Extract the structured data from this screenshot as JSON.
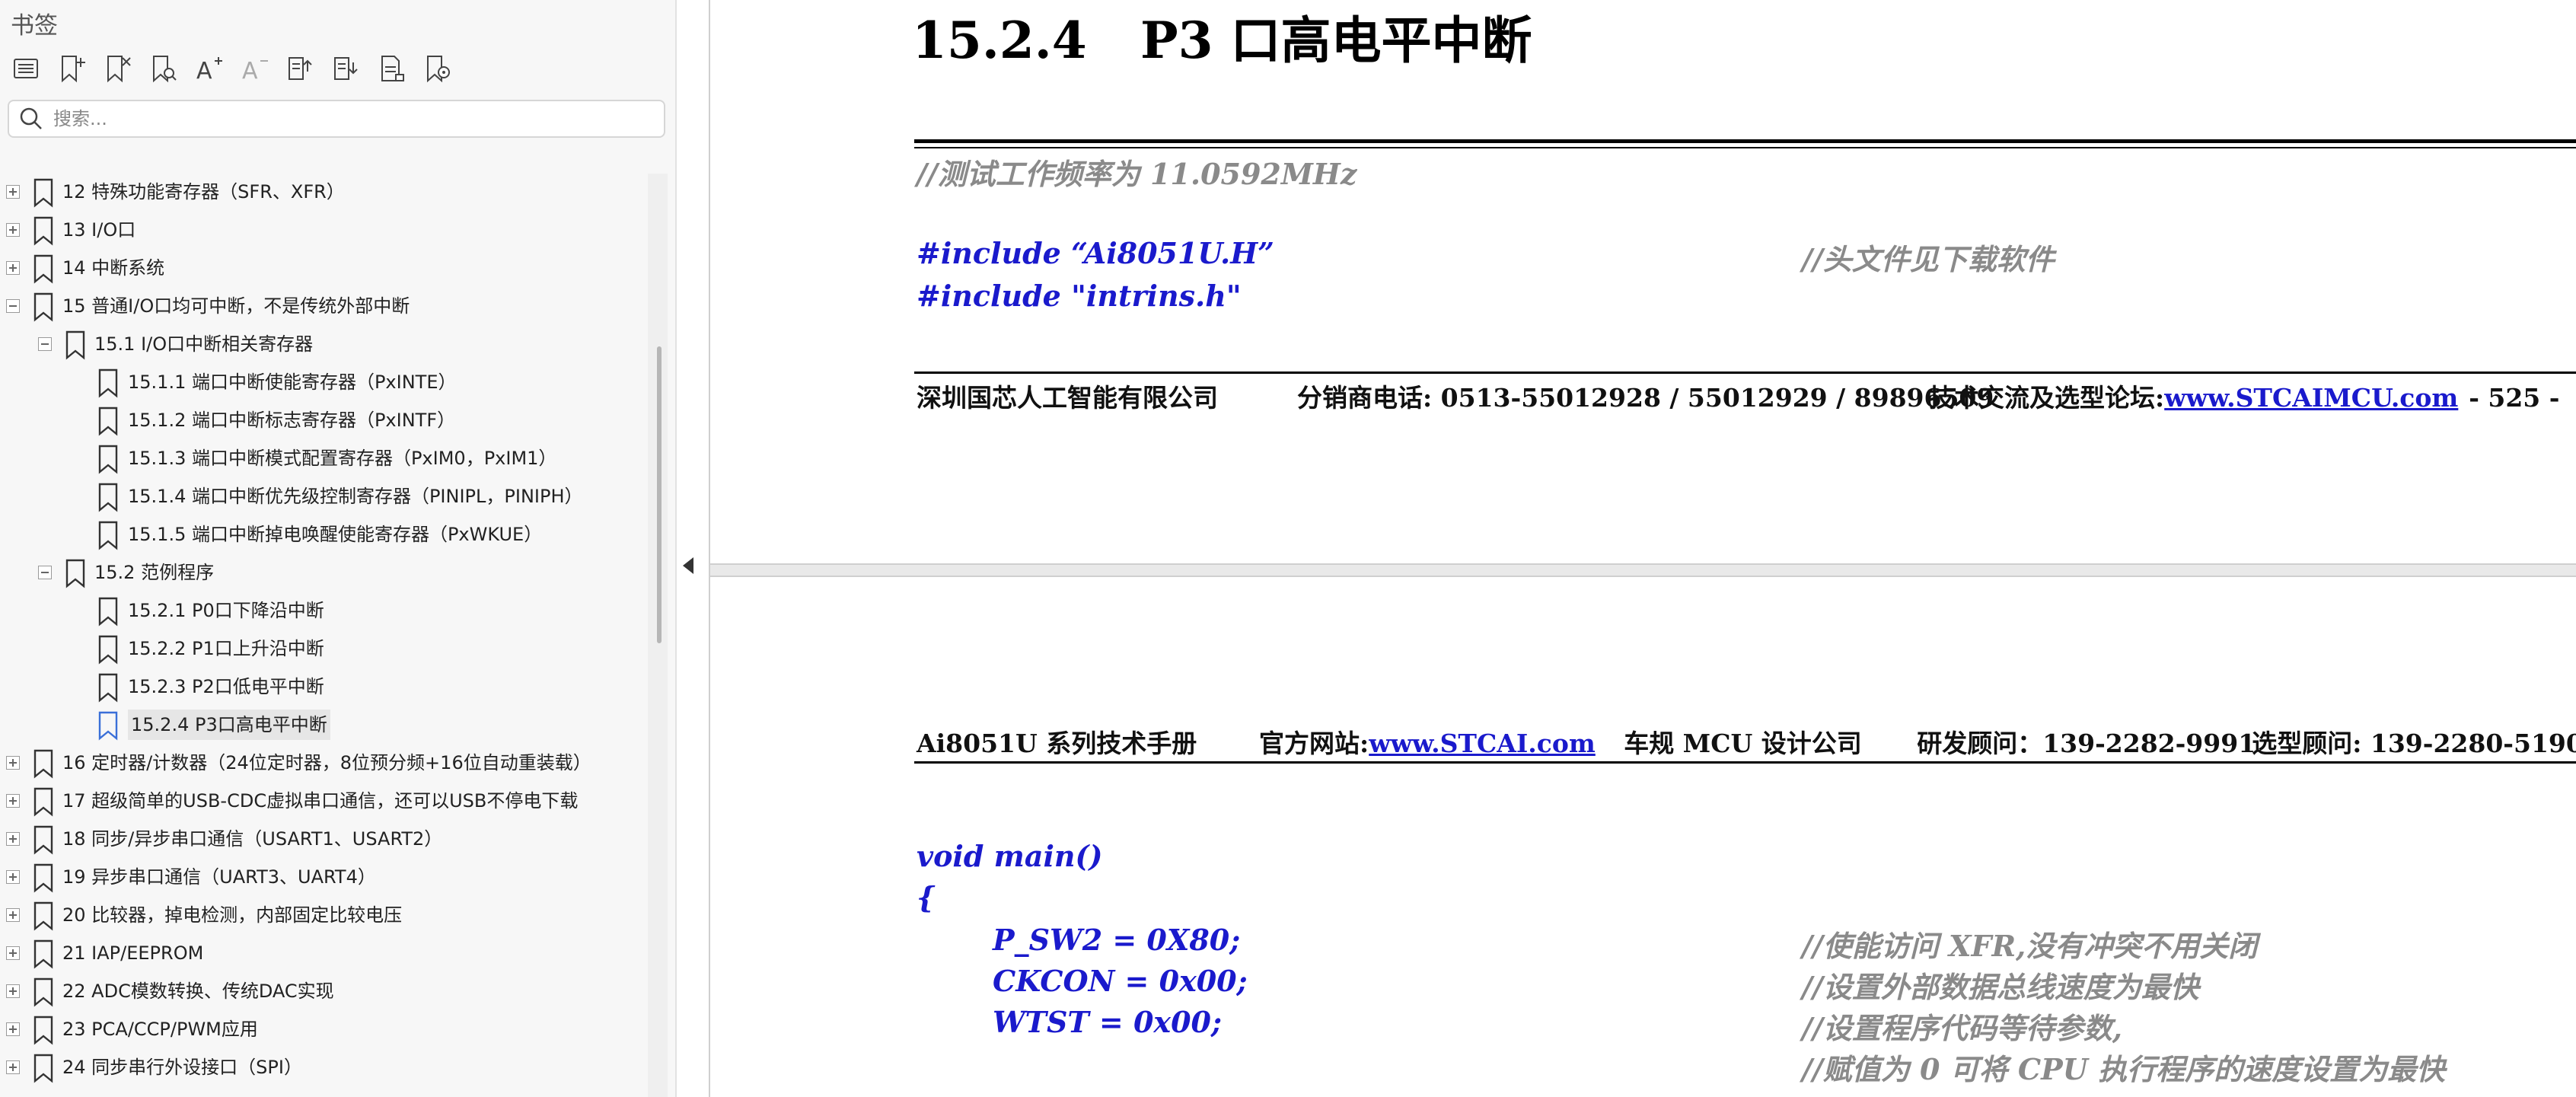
{
  "sidebar": {
    "title": "书签",
    "toolbar": [
      {
        "icon": "list-icon"
      },
      {
        "icon": "add-bookmark-icon"
      },
      {
        "icon": "delete-bookmark-icon"
      },
      {
        "icon": "find-bookmark-icon"
      },
      {
        "icon": "increase-font-icon"
      },
      {
        "icon": "decrease-font-icon"
      },
      {
        "icon": "expand-all-icon"
      },
      {
        "icon": "collapse-all-icon"
      },
      {
        "icon": "bookmark-page-icon"
      },
      {
        "icon": "bookmark-settings-icon"
      }
    ],
    "search_placeholder": "搜索...",
    "tree": [
      {
        "label": "12  特殊功能寄存器（SFR、XFR）",
        "level": 0,
        "expander": "plus"
      },
      {
        "label": "13  I/O口",
        "level": 0,
        "expander": "plus"
      },
      {
        "label": "14  中断系统",
        "level": 0,
        "expander": "plus"
      },
      {
        "label": "15  普通I/O口均可中断，不是传统外部中断",
        "level": 0,
        "expander": "minus"
      },
      {
        "label": "15.1 I/O口中断相关寄存器",
        "level": 1,
        "expander": "minus"
      },
      {
        "label": "15.1.1 端口中断使能寄存器（PxINTE）",
        "level": 2,
        "expander": "none"
      },
      {
        "label": "15.1.2  端口中断标志寄存器（PxINTF）",
        "level": 2,
        "expander": "none"
      },
      {
        "label": "15.1.3 端口中断模式配置寄存器（PxIM0，PxIM1）",
        "level": 2,
        "expander": "none"
      },
      {
        "label": "15.1.4  端口中断优先级控制寄存器（PINIPL，PINIPH）",
        "level": 2,
        "expander": "none"
      },
      {
        "label": "15.1.5 端口中断掉电唤醒使能寄存器（PxWKUE）",
        "level": 2,
        "expander": "none"
      },
      {
        "label": "15.2  范例程序",
        "level": 1,
        "expander": "minus"
      },
      {
        "label": "15.2.1 P0口下降沿中断",
        "level": 2,
        "expander": "none"
      },
      {
        "label": "15.2.2 P1口上升沿中断",
        "level": 2,
        "expander": "none"
      },
      {
        "label": "15.2.3 P2口低电平中断",
        "level": 2,
        "expander": "none"
      },
      {
        "label": "15.2.4 P3口高电平中断",
        "level": 2,
        "expander": "none",
        "selected": true
      },
      {
        "label": "16  定时器/计数器（24位定时器，8位预分频+16位自动重装载）",
        "level": 0,
        "expander": "plus"
      },
      {
        "label": "17  超级简单的USB-CDC虚拟串口通信，还可以USB不停电下载",
        "level": 0,
        "expander": "plus"
      },
      {
        "label": "18  同步/异步串口通信（USART1、USART2）",
        "level": 0,
        "expander": "plus"
      },
      {
        "label": "19  异步串口通信（UART3、UART4）",
        "level": 0,
        "expander": "plus"
      },
      {
        "label": "20  比较器，掉电检测，内部固定比较电压",
        "level": 0,
        "expander": "plus"
      },
      {
        "label": "21  IAP/EEPROM",
        "level": 0,
        "expander": "plus"
      },
      {
        "label": "22  ADC模数转换、传统DAC实现",
        "level": 0,
        "expander": "plus"
      },
      {
        "label": "23  PCA/CCP/PWM应用",
        "level": 0,
        "expander": "plus"
      },
      {
        "label": "24  同步串行外设接口（SPI）",
        "level": 0,
        "expander": "plus"
      }
    ]
  },
  "document": {
    "heading_number": "15.2.4",
    "heading_title": "P3 口高电平中断",
    "page1_lines": {
      "freq_comment": "//测试工作频率为 11.0592MHz",
      "include1": "#include “Ai8051U.H”",
      "include1_comment": "//头文件见下载软件",
      "include2": "#include \"intrins.h\""
    },
    "footer": {
      "company": "深圳国芯人工智能有限公司",
      "phone": "分销商电话: 0513-55012928 / 55012929 / 89896509",
      "forum_label": "技术交流及选型论坛:",
      "forum_link": "www.STCAIMCU.com",
      "page_number": "- 525 -"
    },
    "header": {
      "manual": "Ai8051U 系列技术手册",
      "site_label": "官方网站: ",
      "site_link": "www.STCAI.com",
      "company": "车规 MCU 设计公司",
      "dev_contact": "研发顾问：139-2282-9991",
      "sel_contact": "选型顾问: 139-2280-5190"
    },
    "page2_lines": {
      "main_decl": "void main()",
      "brace": "{",
      "line1": "P_SW2 = 0X80;",
      "line1_comment": "//使能访问 XFR,没有冲突不用关闭",
      "line2": "CKCON = 0x00;",
      "line2_comment": "//设置外部数据总线速度为最快",
      "line3": "WTST = 0x00;",
      "line3_comment": "//设置程序代码等待参数,",
      "line4_comment": "//赋值为 0 可将 CPU 执行程序的速度设置为最快"
    }
  }
}
